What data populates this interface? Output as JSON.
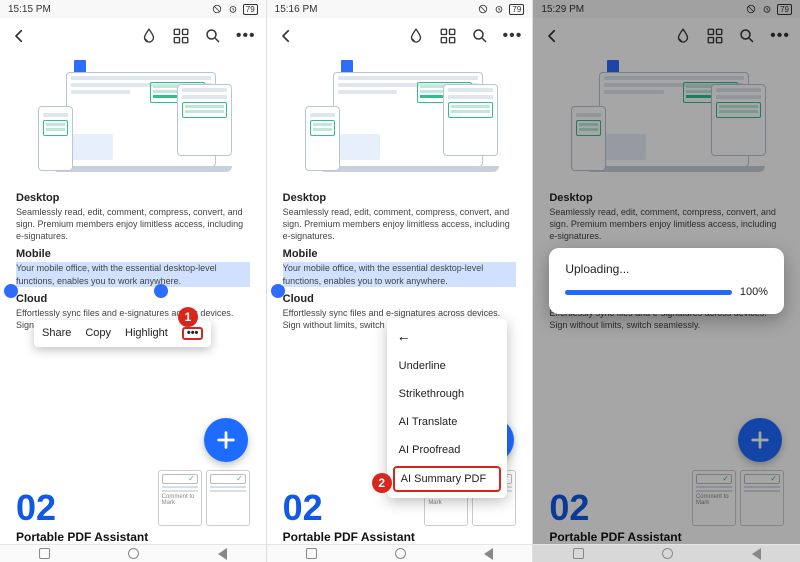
{
  "status": {
    "times": [
      "15:15 PM",
      "15:16 PM",
      "15:29 PM"
    ],
    "battery": "79"
  },
  "sections": {
    "desktop": {
      "title": "Desktop",
      "text": "Seamlessly read, edit, comment, compress, convert, and sign. Premium members enjoy limitless access, including e-signatures."
    },
    "mobile": {
      "title": "Mobile",
      "text": "Your mobile office, with the essential desktop-level functions, enables you to work anywhere."
    },
    "cloud_title": "Cloud",
    "cloud_text_a": "Effortlessly sync files and e-signatures across devices. Sign without limits, switch",
    "cloud_text_b": "Effortlessly sync files and e-signatures across devices. Sign without limits, switch seam",
    "cloud_text_c": "Effortlessly sync files and e-signatures across devices. Sign without limits, switch seamlessly."
  },
  "footer": {
    "pagenum": "02",
    "title": "Portable PDF Assistant",
    "thumb_label": "Comment to Mark"
  },
  "context_menu": {
    "share": "Share",
    "copy": "Copy",
    "highlight": "Highlight",
    "more": "•••",
    "badge": "1"
  },
  "dropdown": {
    "back": "←",
    "items": [
      "Underline",
      "Strikethrough",
      "AI Translate",
      "AI Proofread",
      "AI Summary PDF"
    ],
    "badge": "2"
  },
  "upload": {
    "label": "Uploading...",
    "percent": "100%"
  }
}
